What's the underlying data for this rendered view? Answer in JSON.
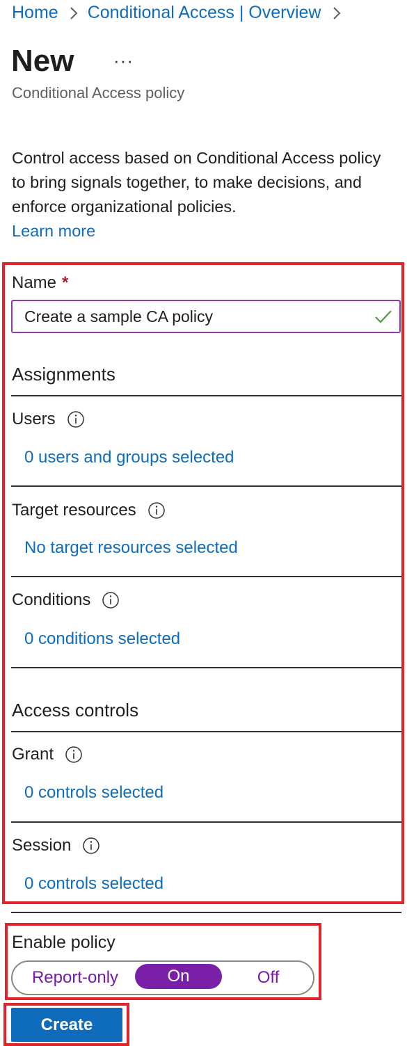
{
  "breadcrumb": {
    "items": [
      "Home",
      "Conditional Access | Overview"
    ]
  },
  "header": {
    "title": "New",
    "more": "···",
    "subtitle": "Conditional Access policy"
  },
  "intro": {
    "description": "Control access based on Conditional Access policy to bring signals together, to make decisions, and enforce organizational policies.",
    "learn_more": "Learn more"
  },
  "form": {
    "name_label": "Name",
    "required_marker": "*",
    "name_value": "Create a sample CA policy",
    "assignments": {
      "heading": "Assignments",
      "users": {
        "label": "Users",
        "value": "0 users and groups selected"
      },
      "target_resources": {
        "label": "Target resources",
        "value": "No target resources selected"
      },
      "conditions": {
        "label": "Conditions",
        "value": "0 conditions selected"
      }
    },
    "access_controls": {
      "heading": "Access controls",
      "grant": {
        "label": "Grant",
        "value": "0 controls selected"
      },
      "session": {
        "label": "Session",
        "value": "0 controls selected"
      }
    }
  },
  "enable_policy": {
    "label": "Enable policy",
    "options": [
      "Report-only",
      "On",
      "Off"
    ],
    "selected": "On"
  },
  "actions": {
    "create_label": "Create"
  },
  "colors": {
    "link": "#0f6cbd",
    "toggle_on": "#7a1fa8",
    "highlight": "#e0242b",
    "primary_button": "#0f6cbd"
  },
  "icons": {
    "breadcrumb_separator": "chevron-right-icon",
    "info": "info-icon",
    "valid": "checkmark-icon"
  }
}
